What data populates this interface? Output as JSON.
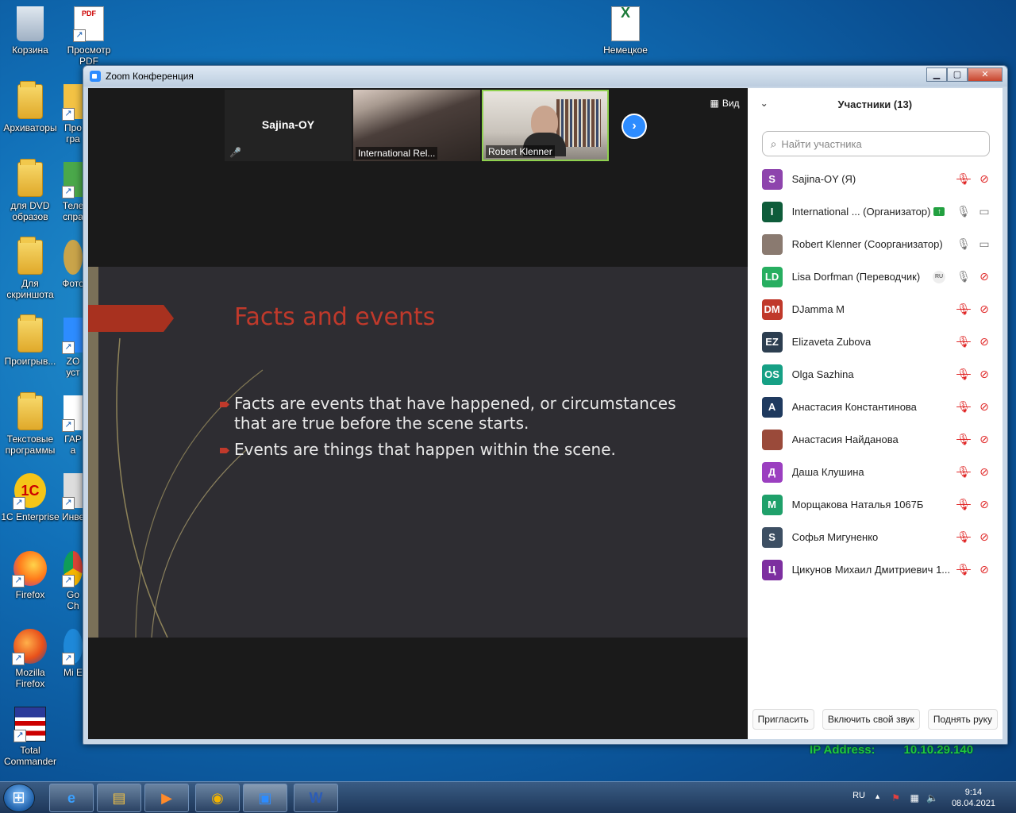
{
  "desktop": {
    "icons": [
      {
        "label": "Корзина"
      },
      {
        "label": "Просмотр PDF"
      },
      {
        "label": "Немецкое"
      },
      {
        "label": "Архиваторы"
      },
      {
        "label": "Про гра"
      },
      {
        "label": "для DVD образов"
      },
      {
        "label": "Теле спра"
      },
      {
        "label": "Для скриншота"
      },
      {
        "label": "Фото"
      },
      {
        "label": "Проигрыв..."
      },
      {
        "label": "ZO уст"
      },
      {
        "label": "Текстовые программы"
      },
      {
        "label": "ГАР а"
      },
      {
        "label": "1C Enterprise"
      },
      {
        "label": "Инве"
      },
      {
        "label": "Firefox"
      },
      {
        "label": "Go Ch"
      },
      {
        "label": "Mozilla Firefox"
      },
      {
        "label": "Mi E"
      },
      {
        "label": "Total Commander"
      }
    ],
    "ip_label": "IP Address:",
    "ip_value": "10.10.29.140"
  },
  "window": {
    "title": "Zoom Конференция",
    "btn_min": "▁",
    "btn_max": "▢",
    "btn_close": "✕"
  },
  "video": {
    "view_label": "Вид",
    "next": "›",
    "thumbs": [
      {
        "name": "Sajina-OY",
        "muted_icon": "🎤"
      },
      {
        "label": "International Rel..."
      },
      {
        "label": "Robert Klenner"
      }
    ]
  },
  "slide": {
    "title": "Facts and events",
    "bullets": [
      "Facts are events that have happened, or circumstances that are true before the scene starts.",
      "Events are things that happen within the scene."
    ]
  },
  "participants": {
    "chevron": "⌄",
    "header": "Участники (13)",
    "search_placeholder": "Найти участника",
    "mic_muted_icon": "🎙",
    "cam_off_icon": "⊘",
    "mic_on_icon": "🎙",
    "cam_on_icon": "▭",
    "list": [
      {
        "initials": "S",
        "color": "#8e44ad",
        "name": "Sajina-OY (Я)",
        "state": "muted"
      },
      {
        "initials": "I",
        "color": "#0e5c3a",
        "name": "International ...  (Организатор)",
        "state": "host"
      },
      {
        "initials": "",
        "color": "#8a7a70",
        "name": "Robert Klenner (Соорганизатор)",
        "state": "on"
      },
      {
        "initials": "LD",
        "color": "#27ae60",
        "name": "Lisa Dorfman (Переводчик)",
        "state": "interp",
        "badge": "RU"
      },
      {
        "initials": "DM",
        "color": "#c0392b",
        "name": "DJamma M",
        "state": "muted"
      },
      {
        "initials": "EZ",
        "color": "#2c3e50",
        "name": "Elizaveta Zubova",
        "state": "muted"
      },
      {
        "initials": "OS",
        "color": "#16a085",
        "name": "Olga Sazhina",
        "state": "muted"
      },
      {
        "initials": "А",
        "color": "#1f3a5f",
        "name": "Анастасия Константинова",
        "state": "muted"
      },
      {
        "initials": "",
        "color": "#9a4a3a",
        "name": "Анастасия Найданова",
        "state": "muted"
      },
      {
        "initials": "Д",
        "color": "#9b3fc0",
        "name": "Даша Клушина",
        "state": "muted"
      },
      {
        "initials": "М",
        "color": "#1fa06a",
        "name": "Морщакова Наталья 1067Б",
        "state": "muted"
      },
      {
        "initials": "S",
        "color": "#3d4f63",
        "name": "Софья Мигуненко",
        "state": "muted"
      },
      {
        "initials": "Ц",
        "color": "#7d2fa0",
        "name": "Цикунов Михаил Дмитриевич 1...",
        "state": "muted"
      }
    ],
    "footer": {
      "invite": "Пригласить",
      "unmute": "Включить свой звук",
      "raise_hand": "Поднять руку"
    }
  },
  "taskbar": {
    "lang": "RU",
    "time": "9:14",
    "date": "08.04.2021",
    "apps": [
      {
        "glyph": "e"
      },
      {
        "glyph": "▤"
      },
      {
        "glyph": "▶"
      },
      {
        "glyph": "◉"
      },
      {
        "glyph": "▣"
      },
      {
        "glyph": "W"
      }
    ],
    "tray": {
      "arrow": "▲",
      "flag": "⚑",
      "net": "▦",
      "vol": "🔈"
    }
  }
}
